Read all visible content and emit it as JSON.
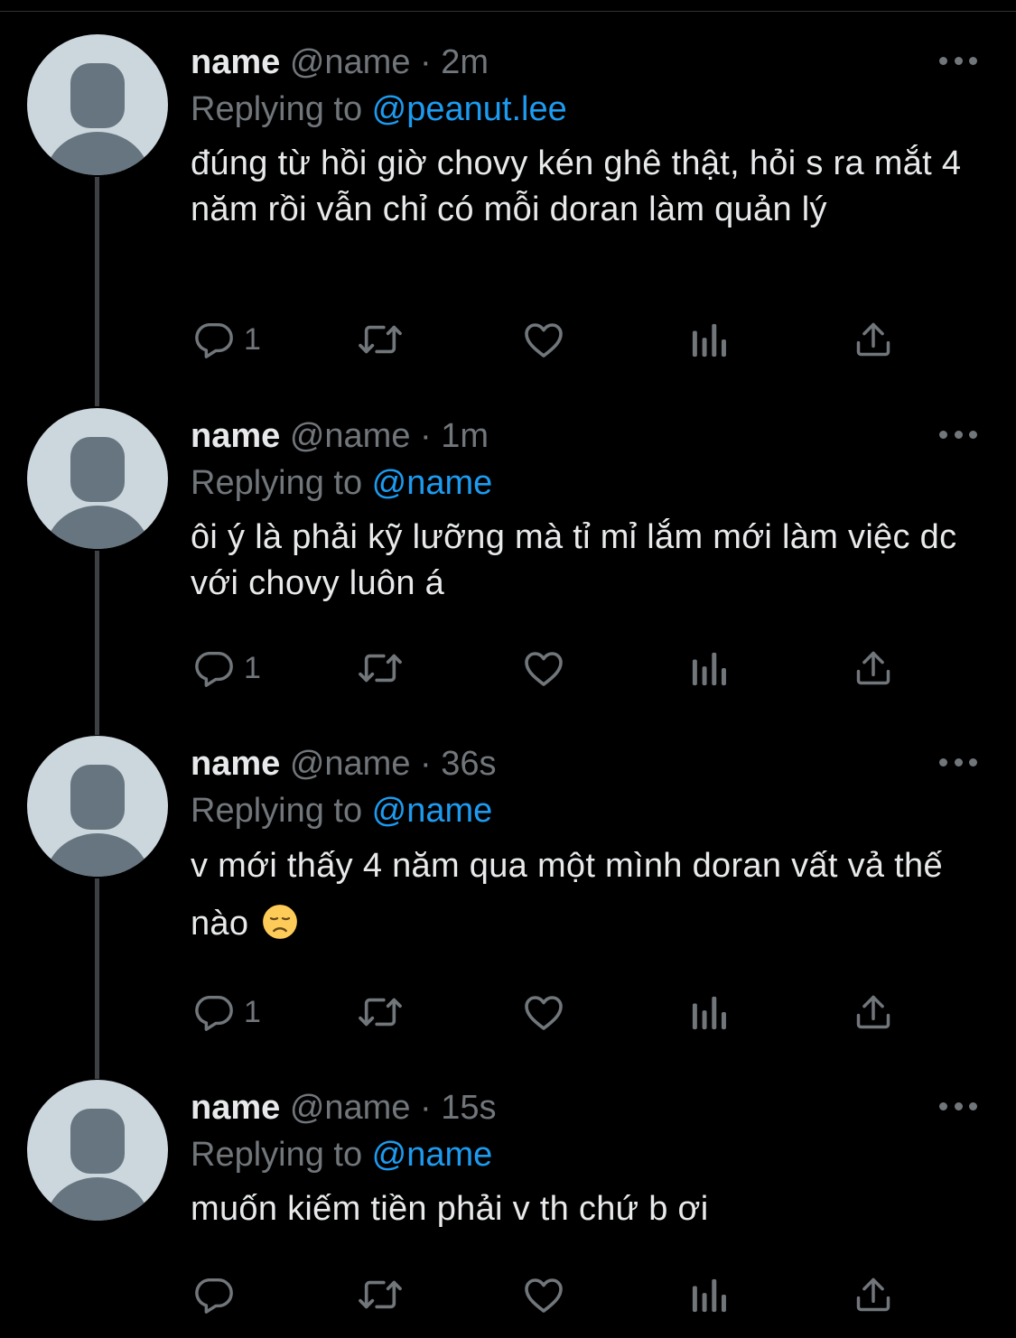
{
  "tweets": [
    {
      "name": "name",
      "handle": "@name",
      "dot": " · ",
      "time": "2m",
      "replying_prefix": "Replying to ",
      "replying_to": "@peanut.lee",
      "text": "đúng từ hồi giờ chovy kén ghê thật, hỏi s ra mắt 4 năm rồi vẫn chỉ có mỗi doran làm quản lý",
      "emoji": "",
      "reply_count": "1"
    },
    {
      "name": "name",
      "handle": "@name",
      "dot": " · ",
      "time": "1m",
      "replying_prefix": "Replying to ",
      "replying_to": "@name",
      "text": "ôi ý là phải kỹ lưỡng mà tỉ mỉ lắm mới làm việc dc với chovy luôn á",
      "emoji": "",
      "reply_count": "1"
    },
    {
      "name": "name",
      "handle": "@name",
      "dot": " · ",
      "time": "36s",
      "replying_prefix": "Replying to ",
      "replying_to": "@name",
      "text": "v mới thấy 4 năm qua một mình doran vất vả thế nào",
      "emoji": "disappointed-face-icon",
      "reply_count": "1"
    },
    {
      "name": "name",
      "handle": "@name",
      "dot": " · ",
      "time": "15s",
      "replying_prefix": "Replying to ",
      "replying_to": "@name",
      "text": "muốn kiếm tiền phải v th chứ b ơi",
      "emoji": "",
      "reply_count": ""
    }
  ],
  "colors": {
    "background": "#000000",
    "text": "#e7e9ea",
    "secondary": "#71767b",
    "link": "#1d9bf0",
    "avatar_bg": "#ccd6dd",
    "avatar_fg": "#66757f"
  },
  "icons": [
    "reply-icon",
    "retweet-icon",
    "like-icon",
    "views-icon",
    "share-icon",
    "more-icon"
  ]
}
